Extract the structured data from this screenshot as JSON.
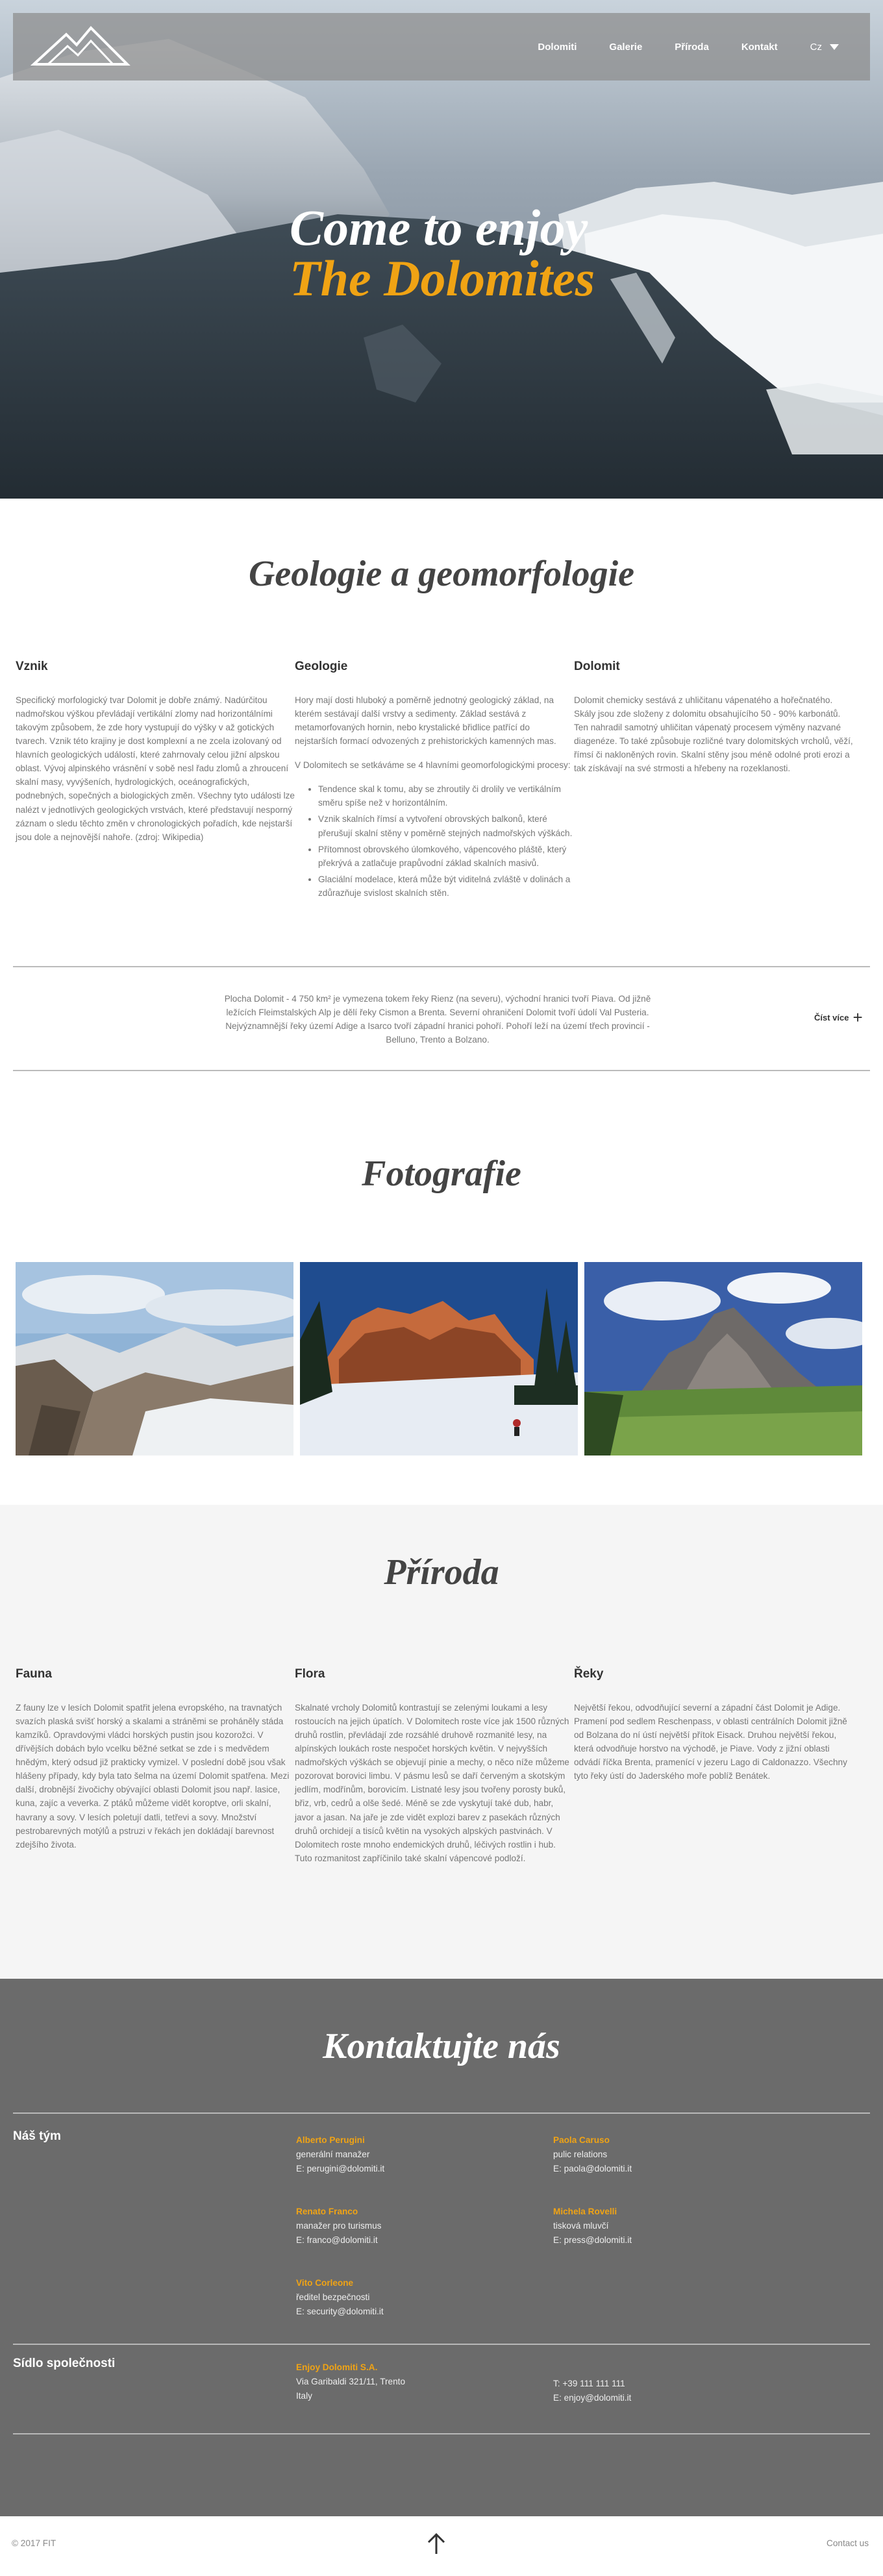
{
  "nav": {
    "items": [
      "Dolomiti",
      "Galerie",
      "Příroda",
      "Kontakt"
    ],
    "lang": "Cz"
  },
  "hero": {
    "line1": "Come to enjoy",
    "line2": "The Dolomites"
  },
  "geologie": {
    "title": "Geologie a geomorfologie",
    "vznik": {
      "heading": "Vznik",
      "text": "Specifický morfologický tvar Dolomit je dobře známý. Nadúrčitou nadmořskou výškou převládají vertikální zlomy nad horizontálními takovým způsobem, že zde hory vystupují do výšky v až gotických tvarech. Vznik této krajiny je dost komplexní a ne zcela izolovaný od hlavních geologických událostí, které zahrnovaly celou jižní alpskou oblast. Vývoj alpinského vrásnění v sobě nesl řadu zlomů a zhroucení skalní masy, vyvýšeních, hydrologických, oceánografických, podnebných, sopečných a biologických změn. Všechny tyto události lze nalézt v jednotlivých geologických vrstvách, které představují nesporný záznam o sledu těchto změn v chronologických pořadích, kde nejstarší jsou dole a nejnovější nahoře. (zdroj: Wikipedia)"
    },
    "geologie": {
      "heading": "Geologie",
      "text1": "Hory mají dosti hluboký a poměrně jednotný geologický základ, na kterém sestávají další vrstvy a sedimenty. Základ sestává z metamorfovaných hornin, nebo krystalické břidlice patřící do nejstarších formací odvozených z prehistorických kamenných mas.",
      "text2": "V Dolomitech se setkáváme se 4 hlavními geomorfologickými procesy:",
      "list": [
        "Tendence skal k tomu, aby se zhroutily či drolily ve vertikálním směru spíše než v horizontálním.",
        "Vznik skalních římsí a vytvoření obrovských balkonů, které přerušují skalní stěny v poměrně stejných nadmořských výškách.",
        "Přítomnost obrovského úlomkového, vápencového pláště, který překrývá a zatlačuje prapůvodní základ skalních masivů.",
        "Glaciální modelace, která může být viditelná zvláště v dolinách a zdůrazňuje svislost skalních stěn."
      ]
    },
    "dolomit": {
      "heading": "Dolomit",
      "text": "Dolomit chemicky sestává z uhličitanu vápenatého a hořečnatého. Skály jsou zde složeny z dolomitu obsahujícího 50 - 90% karbonátů. Ten nahradil samotný uhličitan vápenatý procesem výměny nazvané diagenéze. To také způsobuje rozličné tvary dolomitských vrcholů, věží, římsí či nakloněných rovin. Skalní stěny jsou méně odolné proti erozi a tak získávají na své strmosti a hřebeny na rozeklanosti."
    },
    "plocha": "Plocha Dolomit - 4 750 km² je vymezena tokem řeky Rienz (na severu), východní hranici tvoří Piava. Od jižně ležících Fleimstalských Alp je dělí řeky Cismon a Brenta. Severní ohraničení Dolomit tvoří údolí Val Pusteria. Nejvýznamnější řeky území Adige a Isarco tvoří západní hranici pohoří. Pohoří leží na území třech provincií - Belluno, Trento a Bolzano.",
    "readmore": "Číst více"
  },
  "foto": {
    "title": "Fotografie"
  },
  "priroda": {
    "title": "Příroda",
    "fauna": {
      "heading": "Fauna",
      "text": "Z fauny lze v lesích Dolomit spatřit jelena evropského, na travnatých svazích plaská svišť horský a skalami a stráněmi se proháněly stáda kamzíků. Opravdovými vládci horských pustin jsou kozorožci. V dřívějších dobách bylo vcelku běžné setkat se zde i s medvědem hnědým, který odsud již prakticky vymizel. V poslední době jsou však hlášeny případy, kdy byla tato šelma na území Dolomit spatřena. Mezi další, drobnější živočichy obývající oblasti Dolomit jsou např. lasice, kuna, zajíc a veverka. Z ptáků můžeme vidět koroptve, orli skalní, havrany a sovy. V lesích poletují datli, tetřevi a sovy. Množství pestrobarevných motýlů a pstruzi v řekách jen dokládají barevnost zdejšího života."
    },
    "flora": {
      "heading": "Flora",
      "text": "Skalnaté vrcholy Dolomitů kontrastují se zelenými loukami a lesy rostoucích na jejich úpatích. V Dolomitech roste více jak 1500 různých druhů rostlin, převládají zde rozsáhlé druhově rozmanité lesy, na alpínských loukách roste nespočet horských květin. V nejvyšších nadmořských výškách se objevují pinie a mechy, o něco níže můžeme pozorovat borovici limbu. V pásmu lesů se daří červeným a skotským jedlím, modřínům, borovicím. Listnaté lesy jsou tvořeny porosty buků, břiz, vrb, cedrů a olše šedé. Méně se zde vyskytují také dub, habr, javor a jasan. Na jaře je zde vidět explozi barev z pasekách různých druhů orchidejí a tisíců květin na vysokých alpských pastvinách. V Dolomitech roste mnoho endemických druhů, léčivých rostlin i hub. Tuto rozmanitost zapříčinilo také skalní vápencové podloží."
    },
    "reky": {
      "heading": "Řeky",
      "text": "Největší řekou, odvodňující severní a západní část Dolomit je Adige. Pramení pod sedlem Reschenpass, v oblasti centrálních Dolomit jižně od Bolzana do ní ústí největší přítok Eisack. Druhou největší řekou, která odvodňuje horstvo na východě, je Piave. Vody z jižní oblasti odvádí říčka Brenta, pramenící v jezeru Lago di Caldonazzo. Všechny tyto řeky ústí do Jaderského moře poblíž Benátek."
    }
  },
  "kontakt": {
    "title": "Kontaktujte nás",
    "team_label": "Náš tým",
    "team": [
      {
        "name": "Alberto Perugini",
        "role": "generální manažer",
        "email": "E: perugini@dolomiti.it"
      },
      {
        "name": "Paola Caruso",
        "role": "pulic relations",
        "email": "E: paola@dolomiti.it"
      },
      {
        "name": "Renato Franco",
        "role": "manažer pro turismus",
        "email": "E: franco@dolomiti.it"
      },
      {
        "name": "Michela Rovelli",
        "role": "tisková mluvčí",
        "email": "E: press@dolomiti.it"
      },
      {
        "name": "Vito Corleone",
        "role": "ředitel bezpečnosti",
        "email": "E: security@dolomiti.it"
      }
    ],
    "company_label": "Sídlo společnosti",
    "company": {
      "name": "Enjoy Dolomiti S.A.",
      "street": "Via Garibaldi 321/11, Trento",
      "country": "Italy",
      "phone": "T: +39 111 111 111",
      "email": "E: enjoy@dolomiti.it"
    }
  },
  "footer": {
    "copy": "© 2017 FIT",
    "contact": "Contact us"
  },
  "colors": {
    "accent": "#f0a314",
    "contact_bg": "#6b6b6b",
    "nature_bg": "#f5f5f5"
  }
}
